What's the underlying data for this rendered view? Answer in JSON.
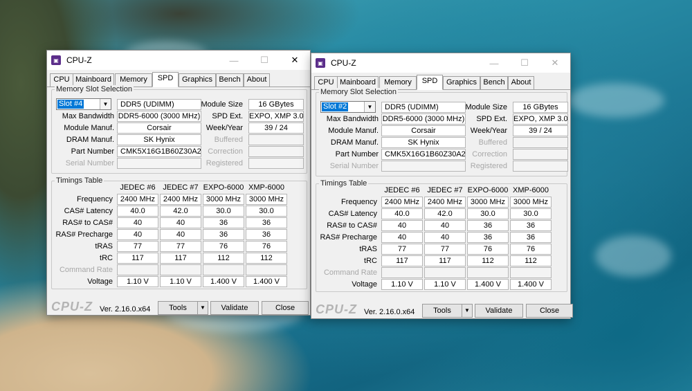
{
  "windows": [
    {
      "title": "CPU-Z",
      "tabs": [
        "CPU",
        "Mainboard",
        "Memory",
        "SPD",
        "Graphics",
        "Bench",
        "About"
      ],
      "active_tab": "SPD",
      "memory_slot_selection": {
        "title": "Memory Slot Selection",
        "slot": "Slot #4",
        "type": "DDR5 (UDIMM)",
        "module_size_label": "Module Size",
        "module_size": "16 GBytes",
        "max_bandwidth_label": "Max Bandwidth",
        "max_bandwidth": "DDR5-6000 (3000 MHz)",
        "spd_ext_label": "SPD Ext.",
        "spd_ext": "EXPO, XMP 3.0",
        "module_manuf_label": "Module Manuf.",
        "module_manuf": "Corsair",
        "week_year_label": "Week/Year",
        "week_year": "39 / 24",
        "dram_manuf_label": "DRAM Manuf.",
        "dram_manuf": "SK Hynix",
        "buffered_label": "Buffered",
        "part_number_label": "Part Number",
        "part_number": "CMK5X16G1B60Z30A2",
        "correction_label": "Correction",
        "serial_number_label": "Serial Number",
        "registered_label": "Registered"
      },
      "timings": {
        "title": "Timings Table",
        "columns": [
          "JEDEC #6",
          "JEDEC #7",
          "EXPO-6000",
          "XMP-6000"
        ],
        "rows": [
          {
            "label": "Frequency",
            "values": [
              "2400 MHz",
              "2400 MHz",
              "3000 MHz",
              "3000 MHz"
            ]
          },
          {
            "label": "CAS# Latency",
            "values": [
              "40.0",
              "42.0",
              "30.0",
              "30.0"
            ]
          },
          {
            "label": "RAS# to CAS#",
            "values": [
              "40",
              "40",
              "36",
              "36"
            ]
          },
          {
            "label": "RAS# Precharge",
            "values": [
              "40",
              "40",
              "36",
              "36"
            ]
          },
          {
            "label": "tRAS",
            "values": [
              "77",
              "77",
              "76",
              "76"
            ]
          },
          {
            "label": "tRC",
            "values": [
              "117",
              "117",
              "112",
              "112"
            ]
          },
          {
            "label": "Command Rate",
            "values": [
              "",
              "",
              "",
              ""
            ]
          },
          {
            "label": "Voltage",
            "values": [
              "1.10 V",
              "1.10 V",
              "1.400 V",
              "1.400 V"
            ]
          }
        ]
      },
      "footer": {
        "logo": "CPU-Z",
        "version": "Ver. 2.16.0.x64",
        "tools": "Tools",
        "validate": "Validate",
        "close": "Close"
      }
    },
    {
      "title": "CPU-Z",
      "tabs": [
        "CPU",
        "Mainboard",
        "Memory",
        "SPD",
        "Graphics",
        "Bench",
        "About"
      ],
      "active_tab": "SPD",
      "memory_slot_selection": {
        "title": "Memory Slot Selection",
        "slot": "Slot #2",
        "type": "DDR5 (UDIMM)",
        "module_size_label": "Module Size",
        "module_size": "16 GBytes",
        "max_bandwidth_label": "Max Bandwidth",
        "max_bandwidth": "DDR5-6000 (3000 MHz)",
        "spd_ext_label": "SPD Ext.",
        "spd_ext": "EXPO, XMP 3.0",
        "module_manuf_label": "Module Manuf.",
        "module_manuf": "Corsair",
        "week_year_label": "Week/Year",
        "week_year": "39 / 24",
        "dram_manuf_label": "DRAM Manuf.",
        "dram_manuf": "SK Hynix",
        "buffered_label": "Buffered",
        "part_number_label": "Part Number",
        "part_number": "CMK5X16G1B60Z30A2",
        "correction_label": "Correction",
        "serial_number_label": "Serial Number",
        "registered_label": "Registered"
      },
      "timings": {
        "title": "Timings Table",
        "columns": [
          "JEDEC #6",
          "JEDEC #7",
          "EXPO-6000",
          "XMP-6000"
        ],
        "rows": [
          {
            "label": "Frequency",
            "values": [
              "2400 MHz",
              "2400 MHz",
              "3000 MHz",
              "3000 MHz"
            ]
          },
          {
            "label": "CAS# Latency",
            "values": [
              "40.0",
              "42.0",
              "30.0",
              "30.0"
            ]
          },
          {
            "label": "RAS# to CAS#",
            "values": [
              "40",
              "40",
              "36",
              "36"
            ]
          },
          {
            "label": "RAS# Precharge",
            "values": [
              "40",
              "40",
              "36",
              "36"
            ]
          },
          {
            "label": "tRAS",
            "values": [
              "77",
              "77",
              "76",
              "76"
            ]
          },
          {
            "label": "tRC",
            "values": [
              "117",
              "117",
              "112",
              "112"
            ]
          },
          {
            "label": "Command Rate",
            "values": [
              "",
              "",
              "",
              ""
            ]
          },
          {
            "label": "Voltage",
            "values": [
              "1.10 V",
              "1.10 V",
              "1.400 V",
              "1.400 V"
            ]
          }
        ]
      },
      "footer": {
        "logo": "CPU-Z",
        "version": "Ver. 2.16.0.x64",
        "tools": "Tools",
        "validate": "Validate",
        "close": "Close"
      }
    }
  ],
  "icons": {
    "minimize": "minimize-icon",
    "maximize": "maximize-icon",
    "close": "close-icon",
    "app": "cpu-z-app-icon"
  },
  "colors": {
    "selection": "#0078d7",
    "window_bg": "#f0f0f0",
    "field_text": "#000000",
    "logo": "#b4b4b4"
  }
}
